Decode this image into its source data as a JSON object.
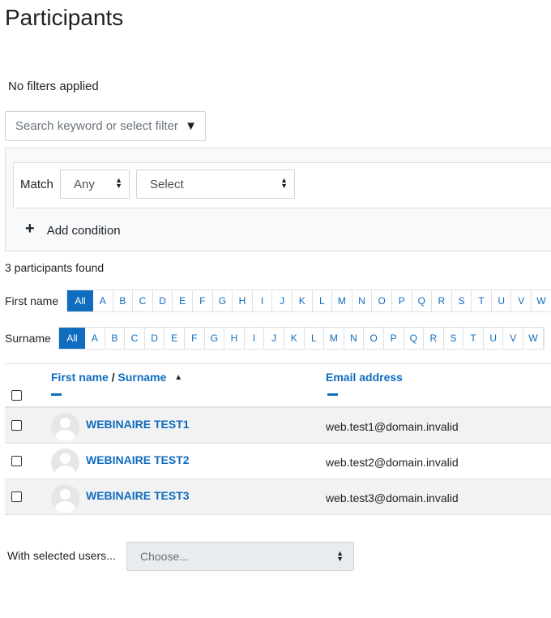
{
  "page": {
    "title": "Participants"
  },
  "filters": {
    "status": "No filters applied",
    "search_placeholder": "Search keyword or select filter",
    "match_label": "Match",
    "match_value": "Any",
    "field_value": "Select",
    "add_condition": "Add condition"
  },
  "summary": {
    "found": "3 participants found"
  },
  "initials": {
    "first_label": "First name",
    "surname_label": "Surname",
    "all": "All",
    "letters": [
      "A",
      "B",
      "C",
      "D",
      "E",
      "F",
      "G",
      "H",
      "I",
      "J",
      "K",
      "L",
      "M",
      "N",
      "O",
      "P",
      "Q",
      "R",
      "S",
      "T",
      "U",
      "V",
      "W"
    ]
  },
  "table": {
    "col_first": "First name",
    "col_sep": "/",
    "col_surname": "Surname",
    "col_email": "Email address",
    "rows": [
      {
        "name": "WEBINAIRE TEST1",
        "email": "web.test1@domain.invalid"
      },
      {
        "name": "WEBINAIRE TEST2",
        "email": "web.test2@domain.invalid"
      },
      {
        "name": "WEBINAIRE TEST3",
        "email": "web.test3@domain.invalid"
      }
    ]
  },
  "bulk": {
    "label": "With selected users...",
    "placeholder": "Choose..."
  },
  "icons": {
    "sort": "caret-up-icon",
    "dropdown": "caret-down-icon",
    "add": "plus-icon",
    "avatar": "user-avatar-icon"
  },
  "colors": {
    "link": "#0f6cbf",
    "border": "#dee2e6",
    "stripe": "#f2f2f2"
  }
}
